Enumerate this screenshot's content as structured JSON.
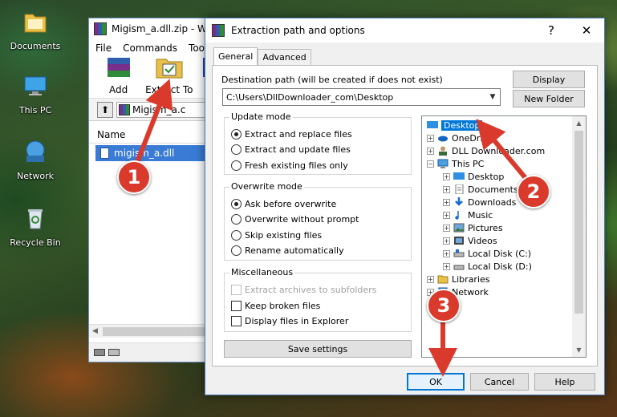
{
  "desktop": {
    "icons": [
      {
        "label": "Documents",
        "icon": "folder-documents-icon"
      },
      {
        "label": "This PC",
        "icon": "computer-icon"
      },
      {
        "label": "Network",
        "icon": "network-icon"
      },
      {
        "label": "Recycle Bin",
        "icon": "recycle-bin-icon"
      }
    ]
  },
  "winrar": {
    "title": "Migism_a.dll.zip - W",
    "menu": [
      "File",
      "Commands",
      "Tools"
    ],
    "toolbar": [
      {
        "label": "Add",
        "icon": "add-archive-icon"
      },
      {
        "label": "Extract To",
        "icon": "extract-to-icon"
      },
      {
        "label": "T",
        "icon": "test-icon"
      }
    ],
    "address": "Migism_a.c",
    "column_name": "Name",
    "file_row": "migism_a.dll"
  },
  "dialog": {
    "title": "Extraction path and options",
    "help_glyph": "?",
    "close_glyph": "✕",
    "tabs": [
      "General",
      "Advanced"
    ],
    "dest_label": "Destination path (will be created if does not exist)",
    "dest_value": "C:\\Users\\DllDownloader_com\\Desktop",
    "display_button": "Display",
    "new_folder_button": "New Folder",
    "update_mode": {
      "title": "Update mode",
      "options": [
        "Extract and replace files",
        "Extract and update files",
        "Fresh existing files only"
      ],
      "selected": 0
    },
    "overwrite_mode": {
      "title": "Overwrite mode",
      "options": [
        "Ask before overwrite",
        "Overwrite without prompt",
        "Skip existing files",
        "Rename automatically"
      ],
      "selected": 0
    },
    "misc": {
      "title": "Miscellaneous",
      "options": [
        "Extract archives to subfolders",
        "Keep broken files",
        "Display files in Explorer"
      ]
    },
    "save_settings": "Save settings",
    "tree": [
      {
        "label": "Desktop",
        "icon": "desktop-icon",
        "selected": true
      },
      {
        "label": "OneDrive",
        "icon": "onedrive-icon"
      },
      {
        "label": "DLL Downloader.com",
        "icon": "user-icon"
      },
      {
        "label": "This PC",
        "icon": "computer-icon"
      },
      {
        "label": "Desktop",
        "icon": "desktop-icon"
      },
      {
        "label": "Documents",
        "icon": "documents-icon"
      },
      {
        "label": "Downloads",
        "icon": "downloads-icon"
      },
      {
        "label": "Music",
        "icon": "music-icon"
      },
      {
        "label": "Pictures",
        "icon": "pictures-icon"
      },
      {
        "label": "Videos",
        "icon": "videos-icon"
      },
      {
        "label": "Local Disk (C:)",
        "icon": "drive-icon"
      },
      {
        "label": "Local Disk (D:)",
        "icon": "drive-icon"
      },
      {
        "label": "Libraries",
        "icon": "libraries-icon"
      },
      {
        "label": "Network",
        "icon": "network-icon"
      }
    ],
    "ok_button": "OK",
    "cancel_button": "Cancel",
    "help_button": "Help"
  },
  "callouts": [
    "1",
    "2",
    "3"
  ],
  "colors": {
    "callout": "#d93a2b",
    "selection": "#0078d7"
  }
}
